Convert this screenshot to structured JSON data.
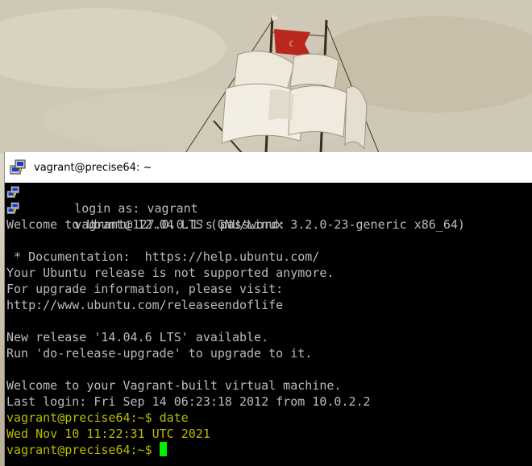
{
  "window": {
    "title": "vagrant@precise64: ~"
  },
  "terminal": {
    "lines": [
      "login as: vagrant",
      "vagrant@127.0.0.1's password:",
      "Welcome to Ubuntu 12.04 LTS (GNU/Linux 3.2.0-23-generic x86_64)",
      "",
      " * Documentation:  https://help.ubuntu.com/",
      "Your Ubuntu release is not supported anymore.",
      "For upgrade information, please visit:",
      "http://www.ubuntu.com/releaseendoflife",
      "",
      "New release '14.04.6 LTS' available.",
      "Run 'do-release-upgrade' to upgrade to it.",
      "",
      "Welcome to your Vagrant-built virtual machine.",
      "Last login: Fri Sep 14 06:23:18 2012 from 10.0.2.2",
      "vagrant@precise64:~$ date",
      "Wed Nov 10 11:22:31 UTC 2021",
      "vagrant@precise64:~$ "
    ]
  },
  "colors": {
    "terminal_bg": "#000000",
    "terminal_fg": "#bbbbbb",
    "prompt_yellow": "#bbbb00",
    "cursor_green": "#00ee00"
  },
  "icons": {
    "app": "putty-icon",
    "login_marker": "putty-icon"
  }
}
